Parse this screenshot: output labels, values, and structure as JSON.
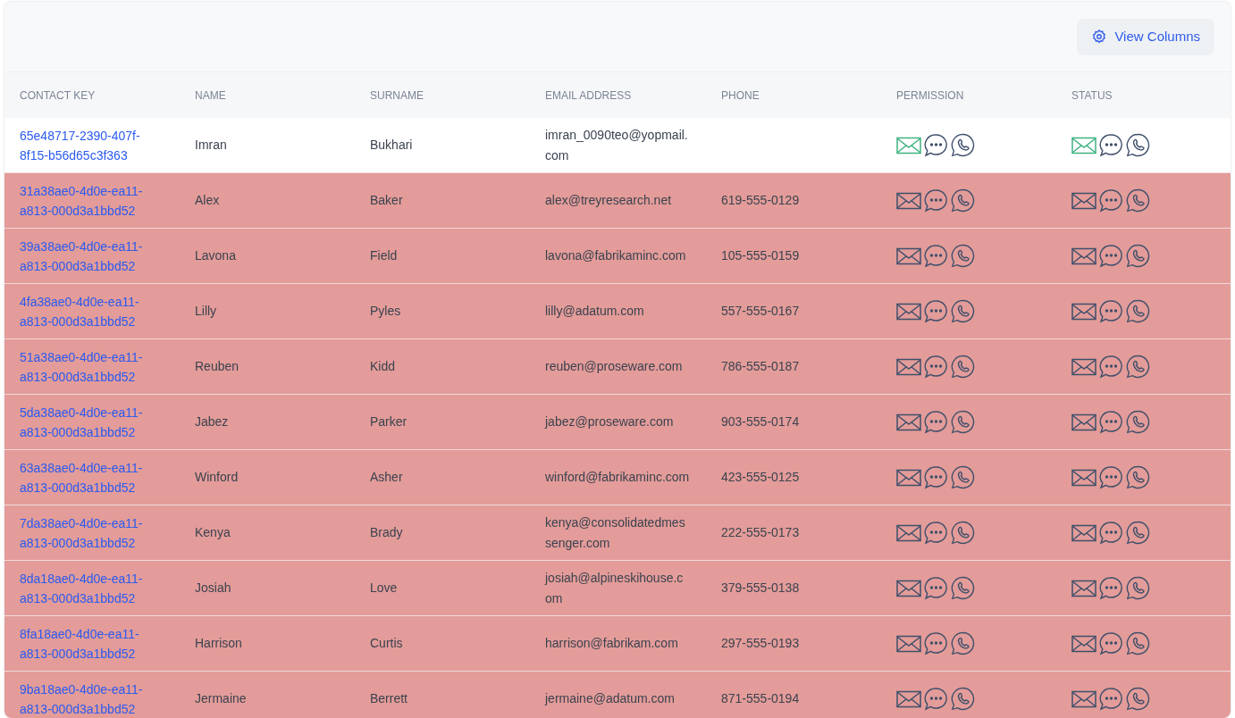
{
  "toolbar": {
    "button": "View Columns"
  },
  "table": {
    "columns": [
      "CONTACT KEY",
      "NAME",
      "SURNAME",
      "EMAIL ADDRESS",
      "PHONE",
      "PERMISSION",
      "STATUS"
    ],
    "rows": [
      {
        "contact_key": "65e48717-2390-407f-8f15-b56d65c3f363",
        "name": "Imran",
        "surname": "Bukhari",
        "email": "imran_0090teo@yopmail.com",
        "phone": "",
        "flagged": false,
        "permission_email": true,
        "status_email": true
      },
      {
        "contact_key": "31a38ae0-4d0e-ea11-a813-000d3a1bbd52",
        "name": "Alex",
        "surname": "Baker",
        "email": "alex@treyresearch.net",
        "phone": "619-555-0129",
        "flagged": true,
        "permission_email": false,
        "status_email": false
      },
      {
        "contact_key": "39a38ae0-4d0e-ea11-a813-000d3a1bbd52",
        "name": "Lavona",
        "surname": "Field",
        "email": "lavona@fabrikaminc.com",
        "phone": "105-555-0159",
        "flagged": true,
        "permission_email": false,
        "status_email": false
      },
      {
        "contact_key": "4fa38ae0-4d0e-ea11-a813-000d3a1bbd52",
        "name": "Lilly",
        "surname": "Pyles",
        "email": "lilly@adatum.com",
        "phone": "557-555-0167",
        "flagged": true,
        "permission_email": false,
        "status_email": false
      },
      {
        "contact_key": "51a38ae0-4d0e-ea11-a813-000d3a1bbd52",
        "name": "Reuben",
        "surname": "Kidd",
        "email": "reuben@proseware.com",
        "phone": "786-555-0187",
        "flagged": true,
        "permission_email": false,
        "status_email": false
      },
      {
        "contact_key": "5da38ae0-4d0e-ea11-a813-000d3a1bbd52",
        "name": "Jabez",
        "surname": "Parker",
        "email": "jabez@proseware.com",
        "phone": "903-555-0174",
        "flagged": true,
        "permission_email": false,
        "status_email": false
      },
      {
        "contact_key": "63a38ae0-4d0e-ea11-a813-000d3a1bbd52",
        "name": "Winford",
        "surname": "Asher",
        "email": "winford@fabrikaminc.com",
        "phone": "423-555-0125",
        "flagged": true,
        "permission_email": false,
        "status_email": false
      },
      {
        "contact_key": "7da38ae0-4d0e-ea11-a813-000d3a1bbd52",
        "name": "Kenya",
        "surname": "Brady",
        "email": "kenya@consolidatedmessenger.com",
        "phone": "222-555-0173",
        "flagged": true,
        "permission_email": false,
        "status_email": false
      },
      {
        "contact_key": "8da18ae0-4d0e-ea11-a813-000d3a1bbd52",
        "name": "Josiah",
        "surname": "Love",
        "email": "josiah@alpineskihouse.com",
        "phone": "379-555-0138",
        "flagged": true,
        "permission_email": false,
        "status_email": false
      },
      {
        "contact_key": "8fa18ae0-4d0e-ea11-a813-000d3a1bbd52",
        "name": "Harrison",
        "surname": "Curtis",
        "email": "harrison@fabrikam.com",
        "phone": "297-555-0193",
        "flagged": true,
        "permission_email": false,
        "status_email": false
      },
      {
        "contact_key": "9ba18ae0-4d0e-ea11-a813-000d3a1bbd52",
        "name": "Jermaine",
        "surname": "Berrett",
        "email": "jermaine@adatum.com",
        "phone": "871-555-0194",
        "flagged": true,
        "permission_email": false,
        "status_email": false
      }
    ]
  }
}
